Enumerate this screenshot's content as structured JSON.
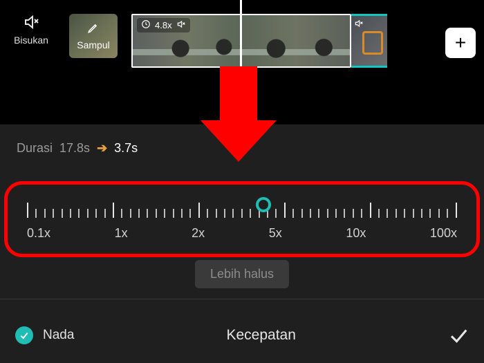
{
  "toolbar": {
    "mute_label": "Bisukan",
    "cover_label": "Sampul",
    "clip_speed": "4.8x",
    "add_label": "+"
  },
  "duration": {
    "label": "Durasi",
    "old": "17.8s",
    "new": "3.7s"
  },
  "slider": {
    "labels": [
      "0.1x",
      "1x",
      "2x",
      "5x",
      "10x",
      "100x"
    ],
    "handle_position_pct": 55
  },
  "smooth_button": "Lebih halus",
  "bottom": {
    "pitch_label": "Nada",
    "panel_title": "Kecepatan"
  },
  "colors": {
    "accent": "#1fbdb4",
    "highlight": "#ff0000",
    "arrow": "#ff0000"
  }
}
